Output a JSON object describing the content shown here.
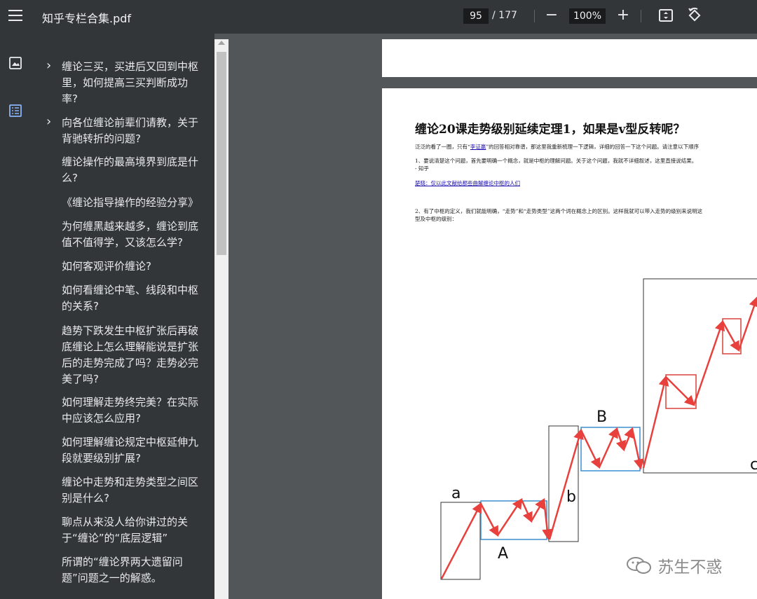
{
  "toolbar": {
    "menu_icon": "hamburger-menu-icon",
    "title": "知乎专栏合集.pdf",
    "current_page": "95",
    "page_separator": "/",
    "total_pages": "177",
    "zoom_out": "−",
    "zoom": "100%",
    "zoom_in": "+"
  },
  "rail": {
    "icons": [
      "image-thumbnails-icon",
      "document-outline-icon"
    ]
  },
  "outline": [
    {
      "label": "缠论三买，买进后又回到中枢里，如何提高三买判断成功率?",
      "expandable": true
    },
    {
      "label": "向各位缠论前辈们请教，关于背驰转折的问题?",
      "expandable": true
    },
    {
      "label": "缠论操作的最高境界到底是什么?",
      "expandable": false
    },
    {
      "label": "《缠论指导操作的经验分享》",
      "expandable": false
    },
    {
      "label": "为何缠黑越来越多，缠论到底值不值得学，又该怎么学?",
      "expandable": false
    },
    {
      "label": "如何客观评价缠论?",
      "expandable": false
    },
    {
      "label": "如何看缠论中笔、线段和中枢的关系?",
      "expandable": false
    },
    {
      "label": "趋势下跌发生中枢扩张后再破底缠论上怎么理解能说是扩张后的走势完成了吗？走势必完美了吗?",
      "expandable": false
    },
    {
      "label": "如何理解走势终完美？在实际中应该怎么应用?",
      "expandable": false
    },
    {
      "label": "如何理解缠论规定中枢延伸九段就要级别扩展?",
      "expandable": false
    },
    {
      "label": "缠论中走势和走势类型之间区别是什么?",
      "expandable": false
    },
    {
      "label": "聊点从来没人给你讲过的关于“缠论”的“底层逻辑”",
      "expandable": false
    },
    {
      "label": "所谓的“缠论界两大遗留问题”问题之一的解惑。",
      "expandable": false
    }
  ],
  "page": {
    "title": "缠论20课走势级别延续定理1，如果是v型反转呢？",
    "p1_a": "泛泛的看了一圈，只有“",
    "p1_link": "李证嬴",
    "p1_b": "”的回答相对靠谱，那这里我重新梳理一下逻辑，详细的回答一下这个问题。请注意以下顺序",
    "p2": "1、要说清楚这个问题，首先要明确一个概念，就是中枢的理解问题。关于这个问题，我就不详细叙述，这里直接说结果。",
    "p2b": "- 知乎",
    "link2": "楚晓：仅以此文献给那些曲解缠论中枢的人们",
    "p3": "2、有了中枢的定义，我们就能明确，“走势”和“走势类型”这两个词在概念上的区别。这样我就可以带入走势的级别来说明这",
    "p3b": "型及中枢的级别："
  },
  "diagram": {
    "labels": [
      "a",
      "A",
      "b",
      "B",
      "c"
    ]
  },
  "watermark": "苏生不惑",
  "colors": {
    "toolbar": "#323639",
    "canvas": "#525659",
    "arrow": "#e8403c",
    "box_blue": "#3b8fd1",
    "box_red": "#d9403a"
  }
}
